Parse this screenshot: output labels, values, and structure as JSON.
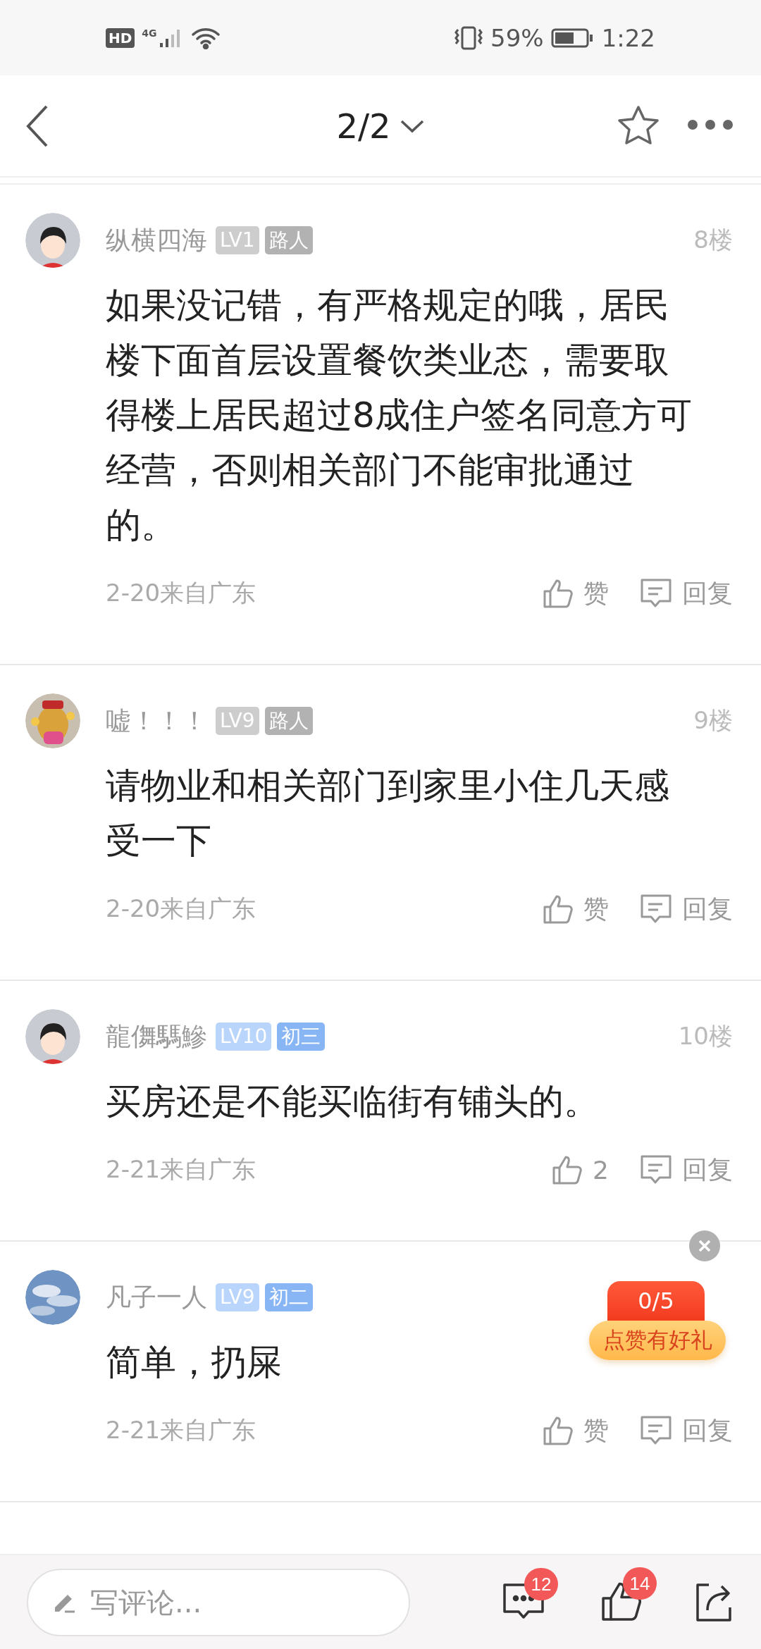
{
  "status_bar": {
    "hd": "HD",
    "network": "4G",
    "battery_percent": "59%",
    "time": "1:22"
  },
  "header": {
    "title": "2/2"
  },
  "comments": [
    {
      "avatar": {
        "kind": "figure"
      },
      "name": "纵横四海",
      "tags": [
        {
          "label": "LV1",
          "color": "#cdcdcd"
        },
        {
          "label": "路人",
          "color": "#b2b2b2"
        }
      ],
      "floor": "8楼",
      "text": "如果没记错，有严格规定的哦，居民楼下面首层设置餐饮类业态，需要取得楼上居民超过8成住户签名同意方可经营，否则相关部门不能审批通过的。",
      "date": "2-20来自广东",
      "like": "赞",
      "reply": "回复"
    },
    {
      "avatar": {
        "kind": "golden"
      },
      "name": "嘘！！！",
      "tags": [
        {
          "label": "LV9",
          "color": "#cdcdcd"
        },
        {
          "label": "路人",
          "color": "#b2b2b2"
        }
      ],
      "floor": "9楼",
      "text": "请物业和相关部门到家里小住几天感受一下",
      "date": "2-20来自广东",
      "like": "赞",
      "reply": "回复"
    },
    {
      "avatar": {
        "kind": "figure"
      },
      "name": "龍儛騳鰺",
      "tags": [
        {
          "label": "LV10",
          "color": "#bad5fb"
        },
        {
          "label": "初三",
          "color": "#88b5f3"
        }
      ],
      "floor": "10楼",
      "text": "买房还是不能买临街有铺头的。",
      "date": "2-21来自广东",
      "like": "2",
      "reply": "回复"
    },
    {
      "avatar": {
        "kind": "sky"
      },
      "name": "凡子一人",
      "tags": [
        {
          "label": "LV9",
          "color": "#bad5fb"
        },
        {
          "label": "初二",
          "color": "#88b5f3"
        }
      ],
      "text": "简单，扔屎",
      "date": "2-21来自广东",
      "like": "赞",
      "reply": "回复"
    }
  ],
  "promo": {
    "count": "0/5",
    "label": "点赞有好礼"
  },
  "bottom_bar": {
    "placeholder": "写评论...",
    "comment_count": "12",
    "like_count": "14"
  }
}
